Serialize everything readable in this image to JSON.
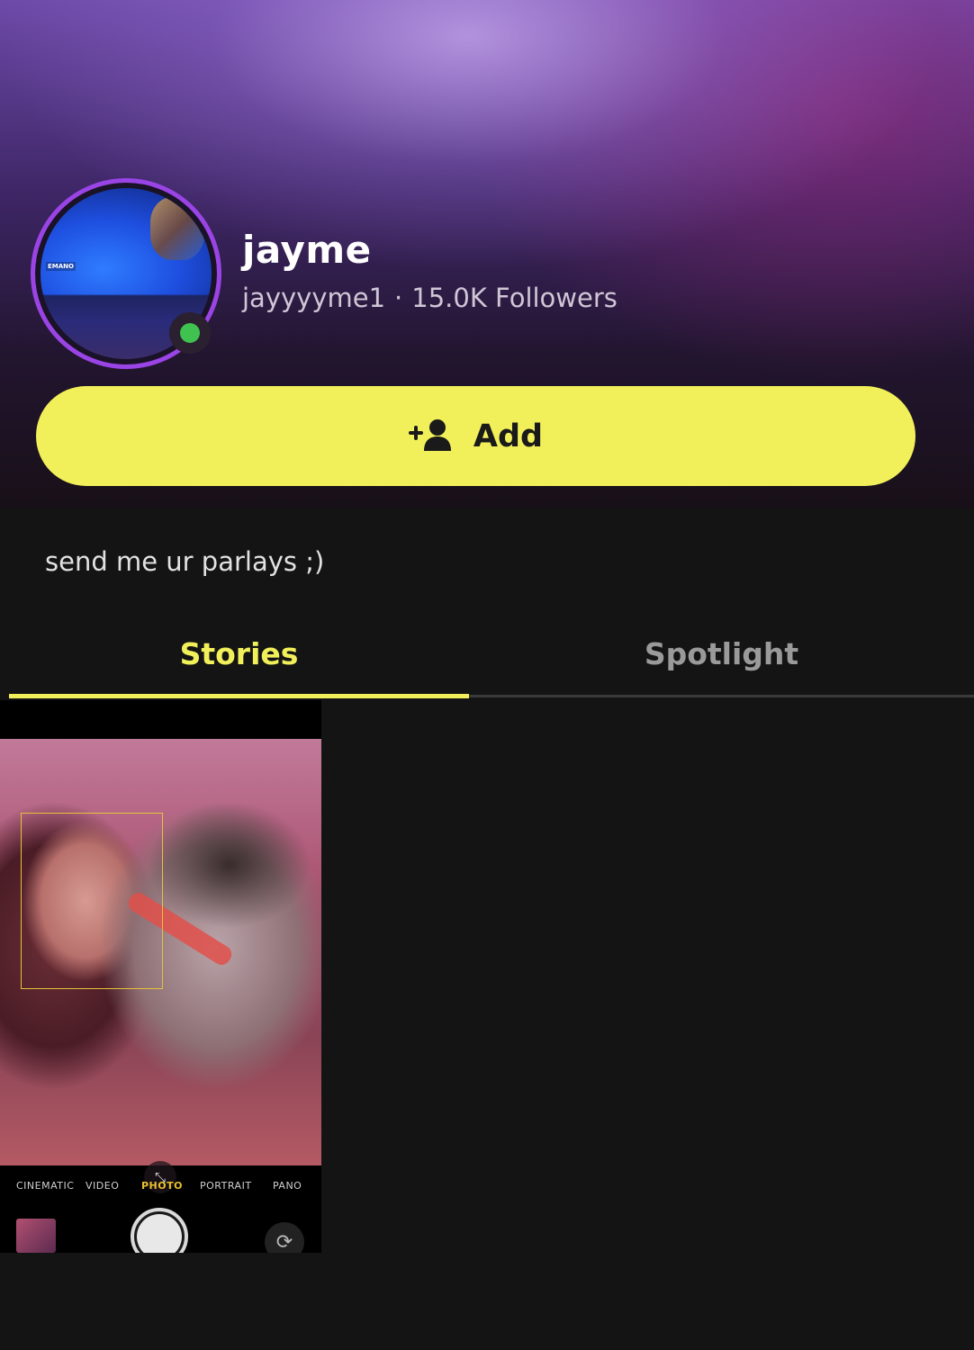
{
  "profile": {
    "display_name": "jayme",
    "username": "jayyyyme1",
    "separator": "·",
    "followers": "15.0K Followers",
    "online": true
  },
  "actions": {
    "add_label": "Add"
  },
  "bio": "send me ur parlays ;)",
  "tabs": [
    {
      "label": "Stories",
      "active": true
    },
    {
      "label": "Spotlight",
      "active": false
    }
  ],
  "story": {
    "camera_modes": [
      "CINEMATIC",
      "VIDEO",
      "PHOTO",
      "PORTRAIT",
      "PANO"
    ],
    "active_mode": "PHOTO",
    "avatar_tag": "EMANO"
  },
  "colors": {
    "accent_yellow": "#f2f05a",
    "ring_purple": "#9a44e6",
    "online_green": "#3fc24f",
    "background": "#141414"
  }
}
